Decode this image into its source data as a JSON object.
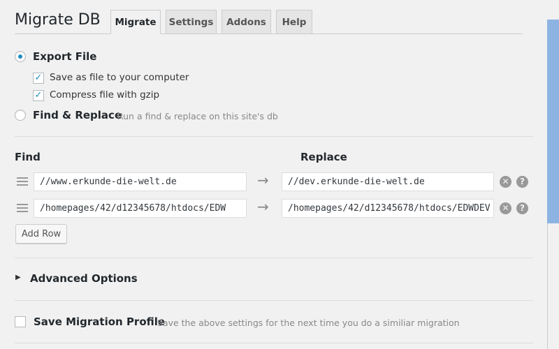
{
  "header": {
    "title": "Migrate DB",
    "tabs": [
      "Migrate",
      "Settings",
      "Addons",
      "Help"
    ],
    "active_tab": "Migrate"
  },
  "export": {
    "label": "Export File",
    "selected": true,
    "options": [
      {
        "label": "Save as file to your computer",
        "checked": true
      },
      {
        "label": "Compress file with gzip",
        "checked": true
      }
    ]
  },
  "find_replace": {
    "label": "Find & Replace",
    "hint": "Run a find & replace on this site's db",
    "selected": false
  },
  "table": {
    "find_header": "Find",
    "replace_header": "Replace",
    "rows": [
      {
        "find": "//www.erkunde-die-welt.de",
        "replace": "//dev.erkunde-die-welt.de"
      },
      {
        "find": "/homepages/42/d12345678/htdocs/EDW",
        "replace": "/homepages/42/d12345678/htdocs/EDWDEV"
      }
    ],
    "add_row": "Add Row"
  },
  "advanced": {
    "label": "Advanced Options"
  },
  "profile": {
    "label": "Save Migration Profile",
    "hint": "Save the above settings for the next time you do a similiar migration",
    "checked": false
  },
  "colors": {
    "accent": "#1e8cbe",
    "scrollbar": "#8db3e2"
  }
}
